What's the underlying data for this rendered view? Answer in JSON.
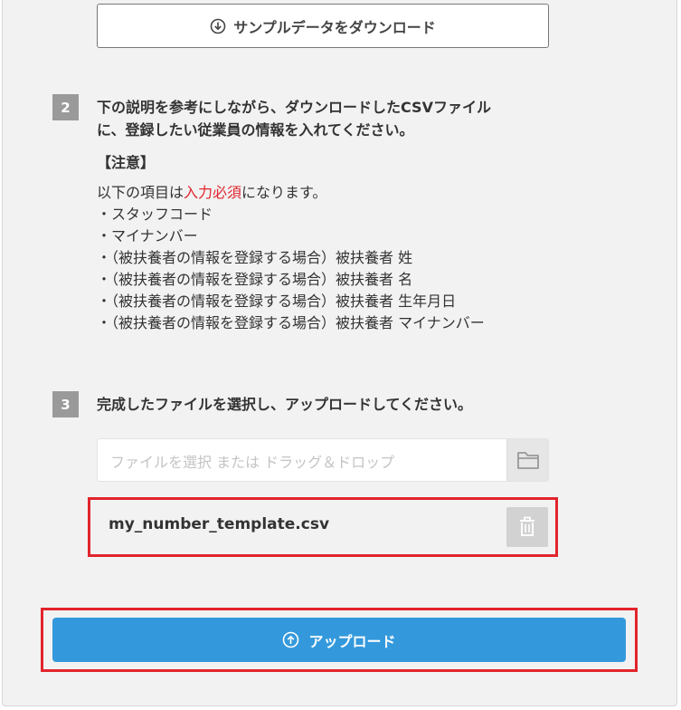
{
  "sample_button": {
    "label": "サンプルデータをダウンロード",
    "icon": "download-circle-icon"
  },
  "steps": [
    {
      "number": "2",
      "lines": [
        "下の説明を参考にしながら、ダウンロードしたCSVファイル",
        "に、登録したい従業員の情報を入れてください。"
      ]
    },
    {
      "number": "3",
      "lines": [
        "完成したファイルを選択し、アップロードしてください。"
      ]
    }
  ],
  "notice": {
    "heading": "【注意】",
    "intro_before": "以下の項目は",
    "intro_required": "入力必須",
    "intro_after": "になります。",
    "items": [
      "・スタッフコード",
      "・マイナンバー",
      "・（被扶養者の情報を登録する場合）被扶養者 姓",
      "・（被扶養者の情報を登録する場合）被扶養者 名",
      "・（被扶養者の情報を登録する場合）被扶養者 生年月日",
      "・（被扶養者の情報を登録する場合）被扶養者 マイナンバー"
    ]
  },
  "file_input": {
    "placeholder": "ファイルを選択 または ドラッグ＆ドロップ",
    "icon": "folder-icon"
  },
  "selected_file": {
    "name": "my_number_template.csv",
    "delete_icon": "trash-icon"
  },
  "upload_button": {
    "label": "アップロード",
    "icon": "upload-circle-icon"
  },
  "colors": {
    "accent": "#3499dc",
    "required_text": "#e0262e",
    "highlight_border": "#e2242c",
    "step_badge": "#9a9a9a"
  }
}
